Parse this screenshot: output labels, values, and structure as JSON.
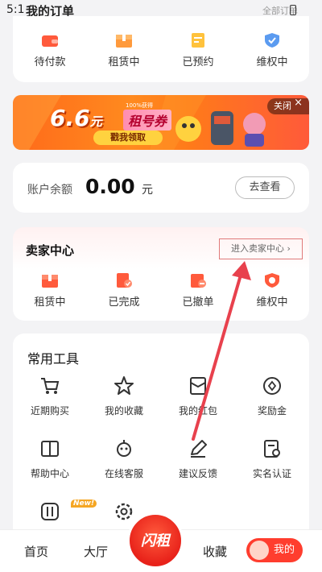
{
  "status_bar": {
    "time": "5:1",
    "title": "我的订单",
    "right_text": "全部订单"
  },
  "orders": {
    "items": [
      {
        "label": "待付款",
        "icon": "wallet-icon"
      },
      {
        "label": "租赁中",
        "icon": "box-icon"
      },
      {
        "label": "已预约",
        "icon": "reservation-icon"
      },
      {
        "label": "维权中",
        "icon": "shield-icon"
      }
    ]
  },
  "banner": {
    "amount": "6.6",
    "unit": "元",
    "tag": "100%获得",
    "coupon": "租号券",
    "claim": "戳我领取",
    "close": "关闭",
    "close_x": "×"
  },
  "balance": {
    "label": "账户余额",
    "amount": "0.00",
    "unit": "元",
    "button": "去查看"
  },
  "seller": {
    "title": "卖家中心",
    "enter": "进入卖家中心 ›",
    "items": [
      {
        "label": "租赁中",
        "icon": "box-icon"
      },
      {
        "label": "已完成",
        "icon": "completed-icon"
      },
      {
        "label": "已撤单",
        "icon": "withdrawn-icon"
      },
      {
        "label": "维权中",
        "icon": "shield-icon"
      }
    ]
  },
  "tools": {
    "title": "常用工具",
    "items": [
      {
        "label": "近期购买",
        "icon": "cart-icon"
      },
      {
        "label": "我的收藏",
        "icon": "star-icon"
      },
      {
        "label": "我的红包",
        "icon": "red-packet-icon"
      },
      {
        "label": "奖励金",
        "icon": "coin-icon"
      },
      {
        "label": "帮助中心",
        "icon": "book-icon"
      },
      {
        "label": "在线客服",
        "icon": "robot-icon"
      },
      {
        "label": "建议反馈",
        "icon": "pen-icon"
      },
      {
        "label": "实名认证",
        "icon": "id-icon"
      },
      {
        "label": "",
        "icon": "sliders-icon"
      },
      {
        "label": "",
        "icon": "settings-icon"
      }
    ],
    "new_badge": "New!"
  },
  "tabbar": {
    "home": "首页",
    "hall": "大厅",
    "center_logo": "闪租",
    "favorites": "收藏",
    "mine": "我的"
  },
  "colors": {
    "accent": "#ff3d2e",
    "annotation": "#e8414d"
  }
}
